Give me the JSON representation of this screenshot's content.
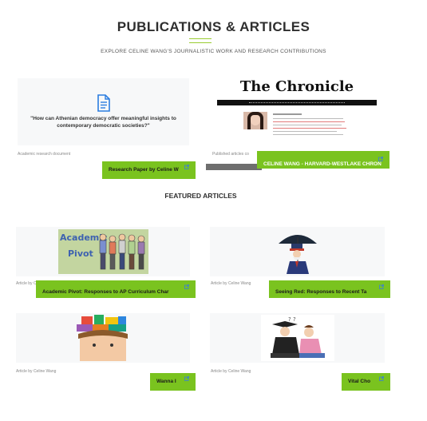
{
  "header": {
    "title": "PUBLICATIONS & ARTICLES",
    "subtitle": "EXPLORE CELINE WANG'S JOURNALISTIC WORK AND RESEARCH CONTRIBUTIONS"
  },
  "top_cards": [
    {
      "quote": "\"How can Athenian democracy offer meaningful insights to contemporary democratic societies?\"",
      "caption": "Academic research document",
      "button": "Research Paper by Celine W",
      "icon": "document-icon"
    },
    {
      "masthead": "The Chronicle",
      "caption": "Published articles co",
      "button": "CELINE WANG - HARVARD-WESTLAKE CHRON",
      "icon": "newspaper-preview"
    }
  ],
  "featured_title": "FEATURED ARTICLES",
  "featured_cards": [
    {
      "caption": "Article by C",
      "button": "Academic Pivot: Responses to AP Curriculum Char",
      "image_text": [
        "Academic",
        "Pivot"
      ]
    },
    {
      "caption": "Article by Celine Wang",
      "button": "Seeing Red: Responses to Recent Ta"
    },
    {
      "caption": "Article by Celine Wang",
      "button": "Wanna I"
    },
    {
      "caption": "Article by Celine Wang",
      "button": "Vital Cho"
    }
  ],
  "colors": {
    "accent": "#7ac31f",
    "card_bg": "#f7f8f9",
    "icon_blue": "#2b7de0"
  }
}
